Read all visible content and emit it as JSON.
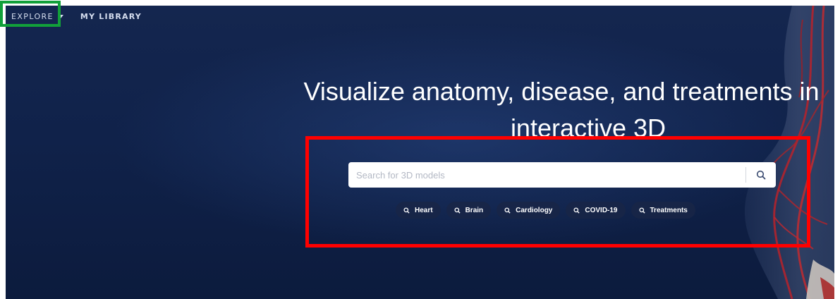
{
  "nav": {
    "explore_label": "EXPLORE",
    "library_label": "MY LIBRARY"
  },
  "hero": {
    "title_line1": "Visualize anatomy, disease, and treatments in",
    "title_line2": "interactive 3D"
  },
  "search": {
    "placeholder": "Search for 3D models",
    "button_icon": "search-icon"
  },
  "chips": [
    {
      "label": "Heart",
      "icon": "search-icon"
    },
    {
      "label": "Brain",
      "icon": "search-icon"
    },
    {
      "label": "Cardiology",
      "icon": "search-icon"
    },
    {
      "label": "COVID-19",
      "icon": "search-icon"
    },
    {
      "label": "Treatments",
      "icon": "search-icon"
    }
  ],
  "colors": {
    "background": "#10224a",
    "highlight_green": "#12a03a",
    "highlight_red": "#ff0000",
    "chip_background": "#192646",
    "text": "#ffffff"
  }
}
